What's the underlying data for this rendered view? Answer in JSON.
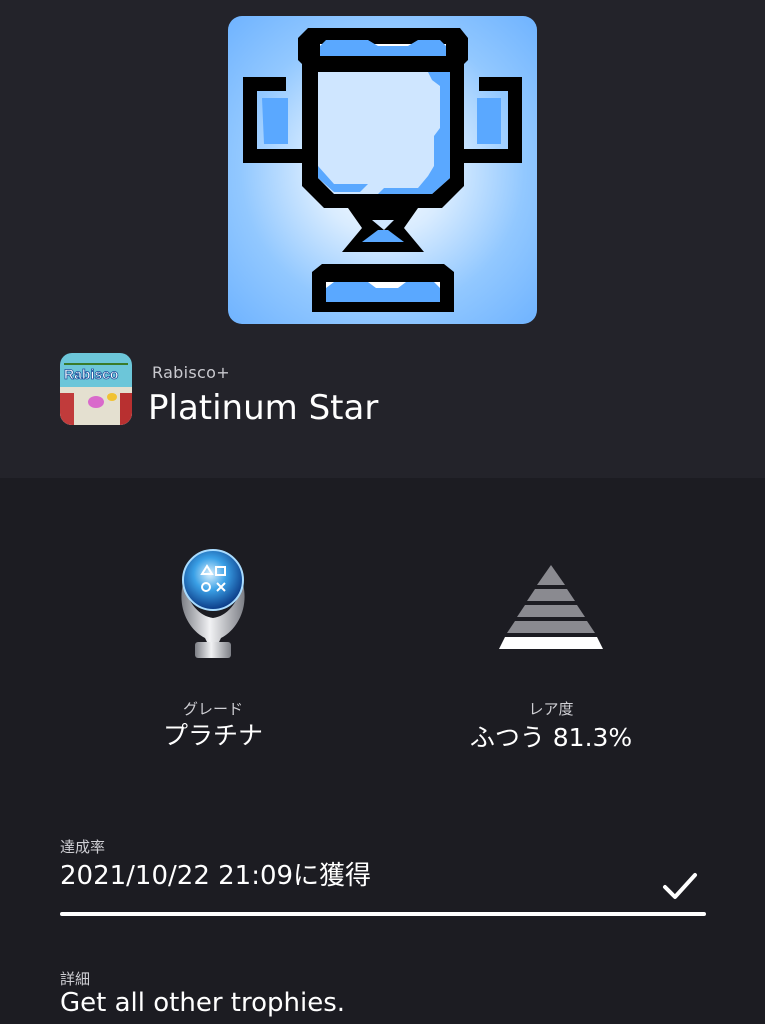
{
  "game": {
    "title": "Rabisco+",
    "icon_text": "Rabisco"
  },
  "trophy": {
    "name": "Platinum Star"
  },
  "grade": {
    "label": "グレード",
    "value": "プラチナ"
  },
  "rarity": {
    "label": "レア度",
    "value": "ふつう 81.3%"
  },
  "progress": {
    "label": "達成率",
    "value": "2021/10/22  21:09に獲得",
    "fraction": 1.0,
    "completed_icon": "checkmark-icon"
  },
  "details": {
    "label": "詳細",
    "text": "Get all other trophies."
  },
  "colors": {
    "background": "#1c1c22",
    "header_background": "#23232a",
    "trophy_art_blue": "#6fb3ff"
  }
}
